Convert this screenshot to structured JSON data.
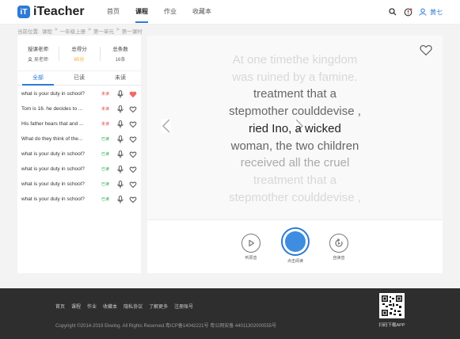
{
  "header": {
    "logo_mark": "iT",
    "logo_text": "iTeacher",
    "nav": [
      "首页",
      "课程",
      "作业",
      "收藏本"
    ],
    "active_nav": "课程",
    "user_name": "黄七"
  },
  "breadcrumb": [
    "当前位置:",
    "课程",
    ">",
    "一年级上册",
    ">",
    "第一单元",
    ">",
    "第一课时"
  ],
  "stats": [
    {
      "label": "授课老师",
      "value": "吴老师"
    },
    {
      "label": "总得分",
      "value": "65分"
    },
    {
      "label": "总条数",
      "value": "16条"
    }
  ],
  "tabs": [
    "全部",
    "已读",
    "未读"
  ],
  "active_tab": "全部",
  "items": [
    {
      "text": "what is your duty in school?",
      "status": "未读",
      "state": "unread",
      "favorited": true
    },
    {
      "text": "Tom is 16. he decides to ...",
      "status": "未读",
      "state": "unread",
      "favorited": false
    },
    {
      "text": "His father hears that and ...",
      "status": "未读",
      "state": "unread",
      "favorited": false
    },
    {
      "text": "What do they think of the...",
      "status": "已读",
      "state": "read",
      "favorited": false
    },
    {
      "text": "what is your duty in school?",
      "status": "已读",
      "state": "read",
      "favorited": false
    },
    {
      "text": "what is your duty in school?",
      "status": "已读",
      "state": "read",
      "favorited": false
    },
    {
      "text": "what is your duty in school?",
      "status": "已读",
      "state": "read",
      "favorited": false
    },
    {
      "text": "what is your duty in school?",
      "status": "已读",
      "state": "read",
      "favorited": false
    }
  ],
  "reader": {
    "lines": [
      "At one timethe kingdom",
      "was ruined by a famine.",
      "treatment that a",
      "stepmother coulddevise ,",
      "ried Ino, a wicked",
      "woman, the two children",
      "received all the cruel",
      "treatment that a",
      "stepmother coulddevise ,"
    ],
    "current_line": 4
  },
  "controls": {
    "left_label": "听原音",
    "center_label": "点击阅读",
    "right_label": "自读音"
  },
  "footer": {
    "links": [
      "首页",
      "课程",
      "作业",
      "收藏本",
      "隐私协议",
      "了解更多",
      "注册账号"
    ],
    "copyright": "Copyright ©2014-2019 Ekwing. All Rights Reserved.粤ICP备14042221号 粤公网安备 44011302000555号",
    "qr_label": "扫码下载APP"
  },
  "colors": {
    "accent": "#2d7bd5",
    "unread": "#e64848",
    "read": "#2aa84a",
    "heart_filled": "#f06a6a",
    "footer_bg": "#2e2e2e"
  }
}
